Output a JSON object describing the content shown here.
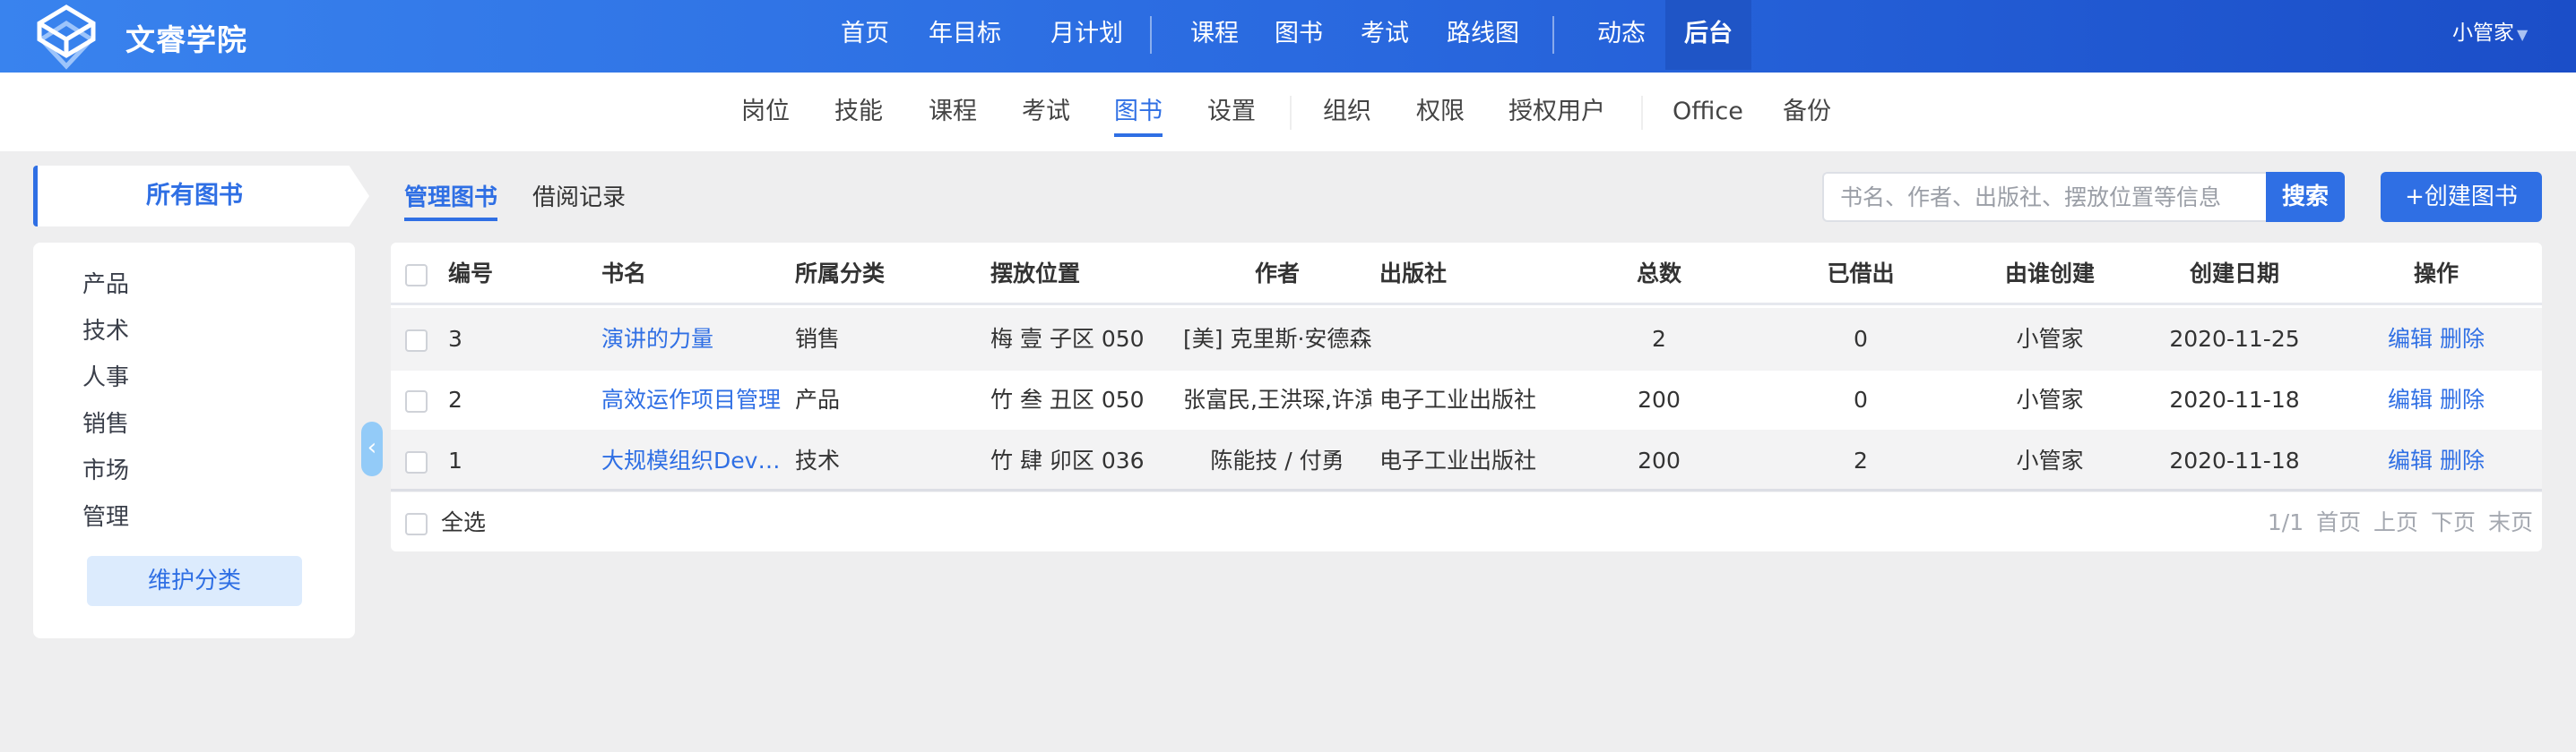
{
  "brand": "文睿学院",
  "top_nav": [
    {
      "label": "首页"
    },
    {
      "label": "年目标"
    },
    {
      "label": "月计划"
    },
    {
      "label": "课程"
    },
    {
      "label": "图书"
    },
    {
      "label": "考试"
    },
    {
      "label": "路线图"
    },
    {
      "label": "动态"
    },
    {
      "label": "后台",
      "active": true
    }
  ],
  "user": {
    "name": "小管家",
    "caret": "▼"
  },
  "sub_nav": [
    {
      "label": "岗位"
    },
    {
      "label": "技能"
    },
    {
      "label": "课程"
    },
    {
      "label": "考试"
    },
    {
      "label": "图书",
      "active": true
    },
    {
      "label": "设置"
    },
    {
      "label": "组织"
    },
    {
      "label": "权限"
    },
    {
      "label": "授权用户"
    },
    {
      "label": "Office"
    },
    {
      "label": "备份"
    }
  ],
  "sidebar": {
    "title": "所有图书",
    "categories": [
      "产品",
      "技术",
      "人事",
      "销售",
      "市场",
      "管理"
    ],
    "maintain_label": "维护分类",
    "collapse_icon": "‹"
  },
  "tabs": [
    {
      "label": "管理图书",
      "active": true
    },
    {
      "label": "借阅记录"
    }
  ],
  "search": {
    "placeholder": "书名、作者、出版社、摆放位置等信息",
    "button": "搜索"
  },
  "create_button": "+创建图书",
  "table": {
    "headers": [
      "编号",
      "书名",
      "所属分类",
      "摆放位置",
      "作者",
      "出版社",
      "总数",
      "已借出",
      "由谁创建",
      "创建日期",
      "操作"
    ],
    "rows": [
      {
        "id": "3",
        "name": "演讲的力量",
        "category": "销售",
        "location": "梅 壹 子区 050",
        "author": "[美] 克里斯·安德森",
        "publisher": "",
        "total": "2",
        "lent": "0",
        "creator": "小管家",
        "date": "2020-11-25",
        "edit": "编辑",
        "delete": "删除"
      },
      {
        "id": "2",
        "name": "高效运作项目管理",
        "category": "产品",
        "location": "竹 叁 丑区 050",
        "author": "张富民,王洪琛,许滨",
        "publisher": "电子工业出版社",
        "total": "200",
        "lent": "0",
        "creator": "小管家",
        "date": "2020-11-18",
        "edit": "编辑",
        "delete": "删除"
      },
      {
        "id": "1",
        "name": "大规模组织DevOps实践",
        "category": "技术",
        "location": "竹 肆 卯区 036",
        "author": "陈能技 / 付勇",
        "publisher": "电子工业出版社",
        "total": "200",
        "lent": "2",
        "creator": "小管家",
        "date": "2020-11-18",
        "edit": "编辑",
        "delete": "删除"
      }
    ],
    "select_all": "全选",
    "pager": {
      "page": "1/1",
      "first": "首页",
      "prev": "上页",
      "next": "下页",
      "last": "末页"
    }
  }
}
